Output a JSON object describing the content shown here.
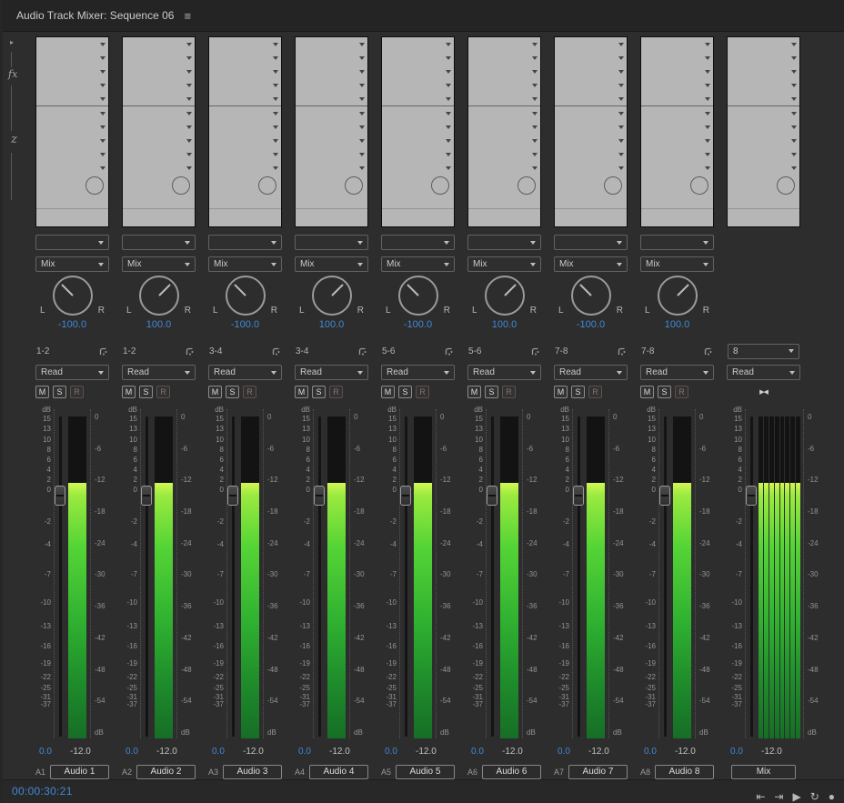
{
  "panel": {
    "title": "Audio Track Mixer: Sequence 06"
  },
  "icons": {
    "panel_menu": "≡",
    "downmix": "▶◀"
  },
  "rail": {
    "collapse_glyph": "▸",
    "effects_label": "fx",
    "sends_label": "z"
  },
  "pan_labels": {
    "left": "L",
    "right": "R"
  },
  "msr": {
    "mute": "M",
    "solo": "S",
    "record": "R"
  },
  "fx_panel": {
    "effect_slots": 5,
    "send_slots": 5
  },
  "meter_scale": {
    "left": [
      "dB",
      "15",
      "13",
      "10",
      "8",
      "6",
      "4",
      "2",
      "0",
      "-2",
      "-4",
      "-7",
      "-10",
      "-13",
      "-16",
      "-19",
      "-22",
      "-25",
      "-31",
      "-37"
    ],
    "right": [
      "0",
      "-6",
      "-12",
      "-18",
      "-24",
      "-30",
      "-36",
      "-42",
      "-48",
      "-54",
      "dB"
    ]
  },
  "strips": [
    {
      "kind": "audio",
      "submix": "Mix",
      "pan": "-100.0",
      "channel_pair": "1-2",
      "automation": "Read",
      "fader_value": "0.0",
      "peak_value": "-12.0",
      "track_id": "A1",
      "track_name": "Audio 1",
      "meter": {
        "bars": 1,
        "level_pct": 79.5
      }
    },
    {
      "kind": "audio",
      "submix": "Mix",
      "pan": "100.0",
      "channel_pair": "1-2",
      "automation": "Read",
      "fader_value": "0.0",
      "peak_value": "-12.0",
      "track_id": "A2",
      "track_name": "Audio 2",
      "meter": {
        "bars": 1,
        "level_pct": 79.5
      }
    },
    {
      "kind": "audio",
      "submix": "Mix",
      "pan": "-100.0",
      "channel_pair": "3-4",
      "automation": "Read",
      "fader_value": "0.0",
      "peak_value": "-12.0",
      "track_id": "A3",
      "track_name": "Audio 3",
      "meter": {
        "bars": 1,
        "level_pct": 79.5
      }
    },
    {
      "kind": "audio",
      "submix": "Mix",
      "pan": "100.0",
      "channel_pair": "3-4",
      "automation": "Read",
      "fader_value": "0.0",
      "peak_value": "-12.0",
      "track_id": "A4",
      "track_name": "Audio 4",
      "meter": {
        "bars": 1,
        "level_pct": 79.5
      }
    },
    {
      "kind": "audio",
      "submix": "Mix",
      "pan": "-100.0",
      "channel_pair": "5-6",
      "automation": "Read",
      "fader_value": "0.0",
      "peak_value": "-12.0",
      "track_id": "A5",
      "track_name": "Audio 5",
      "meter": {
        "bars": 1,
        "level_pct": 79.5
      }
    },
    {
      "kind": "audio",
      "submix": "Mix",
      "pan": "100.0",
      "channel_pair": "5-6",
      "automation": "Read",
      "fader_value": "0.0",
      "peak_value": "-12.0",
      "track_id": "A6",
      "track_name": "Audio 6",
      "meter": {
        "bars": 1,
        "level_pct": 79.5
      }
    },
    {
      "kind": "audio",
      "submix": "Mix",
      "pan": "-100.0",
      "channel_pair": "7-8",
      "automation": "Read",
      "fader_value": "0.0",
      "peak_value": "-12.0",
      "track_id": "A7",
      "track_name": "Audio 7",
      "meter": {
        "bars": 1,
        "level_pct": 79.5
      }
    },
    {
      "kind": "audio",
      "submix": "Mix",
      "pan": "100.0",
      "channel_pair": "7-8",
      "automation": "Read",
      "fader_value": "0.0",
      "peak_value": "-12.0",
      "track_id": "A8",
      "track_name": "Audio 8",
      "meter": {
        "bars": 1,
        "level_pct": 79.5
      }
    },
    {
      "kind": "master",
      "output_channels": "8",
      "automation": "Read",
      "fader_value": "0.0",
      "peak_value": "-12.0",
      "track_name": "Mix",
      "meter": {
        "bars": 8,
        "level_pct": 79.5
      }
    }
  ],
  "footer": {
    "timecode": "00:00:30:21",
    "transport": [
      {
        "name": "go-to-in",
        "glyph": "⇤"
      },
      {
        "name": "go-to-out",
        "glyph": "⇥"
      },
      {
        "name": "play",
        "glyph": "▶"
      },
      {
        "name": "loop",
        "glyph": "↻"
      },
      {
        "name": "record",
        "glyph": "●"
      }
    ]
  }
}
